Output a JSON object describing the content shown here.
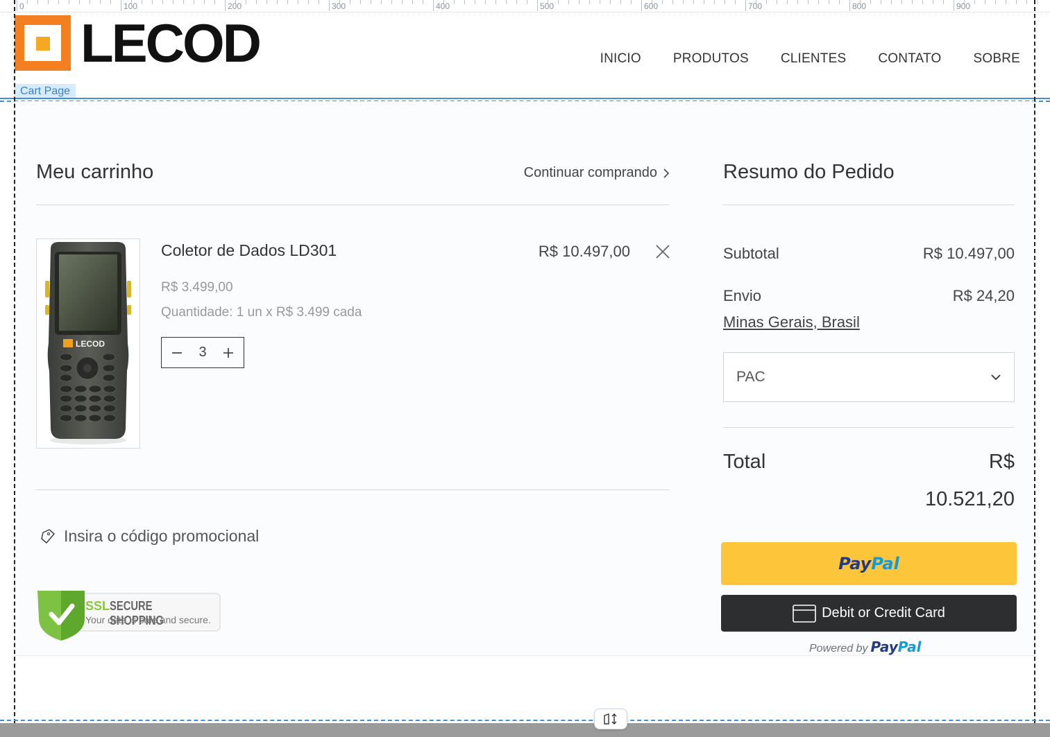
{
  "editor": {
    "ruler_labels": [
      "0",
      "100",
      "200",
      "300",
      "400",
      "500",
      "600",
      "700",
      "800",
      "900"
    ],
    "page_tag": "Cart Page",
    "handle_icon": "resize-height-icon"
  },
  "brand": {
    "name": "LECOD",
    "colors": {
      "orange": "#f47f20",
      "yellow": "#f7a823"
    }
  },
  "nav": {
    "items": [
      "INICIO",
      "PRODUTOS",
      "CLIENTES",
      "CONTATO",
      "SOBRE"
    ]
  },
  "cart": {
    "title": "Meu carrinho",
    "continue_label": "Continuar comprando",
    "item": {
      "name": "Coletor de Dados LD301",
      "line_total": "R$ 10.497,00",
      "unit_price": "R$ 3.499,00",
      "quantity_text": "Quantidade: 1 un x R$ 3.499 cada",
      "quantity": "3",
      "image_brand": "LECOD"
    },
    "promo_label": "Insira o código promocional",
    "ssl": {
      "title_a": "SSL",
      "title_b": "SECURE SHOPPING",
      "subtitle": "Your data is safe and secure."
    }
  },
  "summary": {
    "title": "Resumo do Pedido",
    "subtotal_label": "Subtotal",
    "subtotal_value": "R$ 10.497,00",
    "shipping_label": "Envio",
    "shipping_value": "R$ 24,20",
    "region": "Minas Gerais, Brasil",
    "shipping_method": "PAC",
    "total_label": "Total",
    "total_currency": "R$",
    "total_value": "10.521,20"
  },
  "payment": {
    "paypal_a": "Pay",
    "paypal_b": "Pal",
    "card_label": "Debit or Credit Card",
    "powered_by": "Powered by",
    "colors": {
      "paypal_yellow": "#fcc53a",
      "card_dark": "#2c2e2f"
    }
  }
}
